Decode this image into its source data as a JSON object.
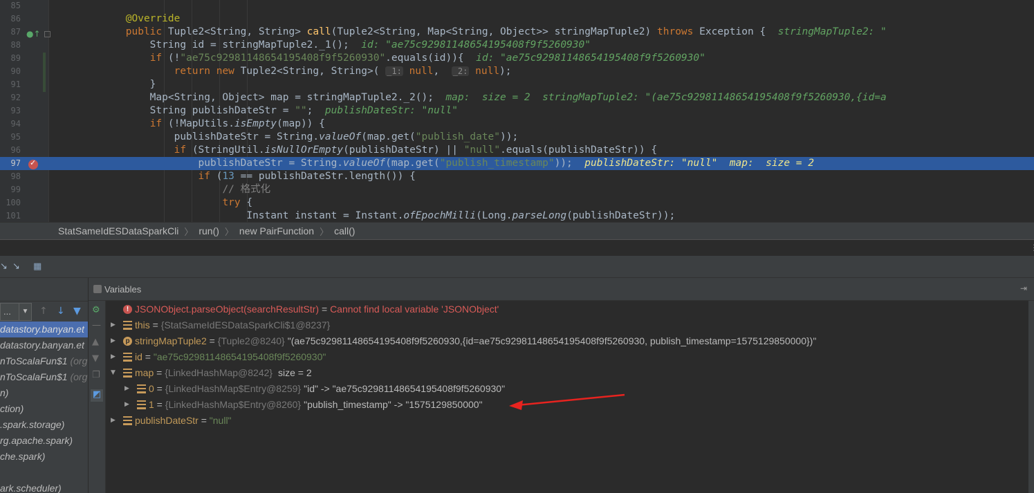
{
  "editor": {
    "lines": [
      {
        "n": "85",
        "segs": []
      },
      {
        "n": "86",
        "segs": [
          {
            "t": "            "
          },
          {
            "t": "@Override",
            "c": "ann"
          }
        ]
      },
      {
        "n": "87",
        "segs": [
          {
            "t": "            "
          },
          {
            "t": "public ",
            "c": "kw"
          },
          {
            "t": "Tuple2<String, String> "
          },
          {
            "t": "call",
            "c": "fn"
          },
          {
            "t": "(Tuple2<String, Map<String, Object>> stringMapTuple2) "
          },
          {
            "t": "throws ",
            "c": "kw"
          },
          {
            "t": "Exception {  "
          },
          {
            "t": "stringMapTuple2: \"",
            "c": "hint"
          }
        ]
      },
      {
        "n": "88",
        "segs": [
          {
            "t": "                String id = stringMapTuple2."
          },
          {
            "t": "_1",
            "c": ""
          },
          {
            "t": "();  "
          },
          {
            "t": "id: \"ae75c92981148654195408f9f5260930\"",
            "c": "hint"
          }
        ]
      },
      {
        "n": "89",
        "segs": [
          {
            "t": "                "
          },
          {
            "t": "if ",
            "c": "kw"
          },
          {
            "t": "(!"
          },
          {
            "t": "\"ae75c92981148654195408f9f5260930\"",
            "c": "str"
          },
          {
            "t": ".equals(id)){  "
          },
          {
            "t": "id: \"ae75c92981148654195408f9f5260930\"",
            "c": "hint"
          }
        ]
      },
      {
        "n": "90",
        "segs": [
          {
            "t": "                    "
          },
          {
            "t": "return new ",
            "c": "kw"
          },
          {
            "t": "Tuple2<String, String>( "
          },
          {
            "t": "_1:",
            "c": "ph"
          },
          {
            "t": " "
          },
          {
            "t": "null",
            "c": "kw"
          },
          {
            "t": ",  "
          },
          {
            "t": "_2:",
            "c": "ph"
          },
          {
            "t": " "
          },
          {
            "t": "null",
            "c": "kw"
          },
          {
            "t": ");"
          }
        ]
      },
      {
        "n": "91",
        "segs": [
          {
            "t": "                }"
          }
        ]
      },
      {
        "n": "92",
        "segs": [
          {
            "t": "                Map<String, Object> map = stringMapTuple2._2();  "
          },
          {
            "t": "map:  size = 2  stringMapTuple2: \"(ae75c92981148654195408f9f5260930,{id=a",
            "c": "hint"
          }
        ]
      },
      {
        "n": "93",
        "segs": [
          {
            "t": "                String publishDateStr = "
          },
          {
            "t": "\"\"",
            "c": "str"
          },
          {
            "t": ";  "
          },
          {
            "t": "publishDateStr: \"null\"",
            "c": "hint"
          }
        ]
      },
      {
        "n": "94",
        "segs": [
          {
            "t": "                "
          },
          {
            "t": "if ",
            "c": "kw"
          },
          {
            "t": "(!MapUtils."
          },
          {
            "t": "isEmpty",
            "c": "it"
          },
          {
            "t": "(map)) {"
          }
        ]
      },
      {
        "n": "95",
        "segs": [
          {
            "t": "                    publishDateStr = String."
          },
          {
            "t": "valueOf",
            "c": "it"
          },
          {
            "t": "(map.get("
          },
          {
            "t": "\"publish_date\"",
            "c": "str"
          },
          {
            "t": "));"
          }
        ]
      },
      {
        "n": "96",
        "segs": [
          {
            "t": "                    "
          },
          {
            "t": "if ",
            "c": "kw"
          },
          {
            "t": "(StringUtil."
          },
          {
            "t": "isNullOrEmpty",
            "c": "it"
          },
          {
            "t": "(publishDateStr) || "
          },
          {
            "t": "\"null\"",
            "c": "str"
          },
          {
            "t": ".equals(publishDateStr)) {"
          }
        ]
      },
      {
        "n": "97",
        "active": true,
        "segs": [
          {
            "t": "                        publishDateStr = String."
          },
          {
            "t": "valueOf",
            "c": "it"
          },
          {
            "t": "(map.get("
          },
          {
            "t": "\"publish_timestamp\"",
            "c": "str"
          },
          {
            "t": "));  "
          },
          {
            "t": "publishDateStr: \"null\"  map:  size = 2",
            "c": "hintA"
          }
        ]
      },
      {
        "n": "98",
        "segs": [
          {
            "t": "                        "
          },
          {
            "t": "if ",
            "c": "kw"
          },
          {
            "t": "("
          },
          {
            "t": "13",
            "c": "num"
          },
          {
            "t": " == publishDateStr.length()) {"
          }
        ]
      },
      {
        "n": "99",
        "segs": [
          {
            "t": "                            "
          },
          {
            "t": "// 格式化",
            "c": "cmt"
          }
        ]
      },
      {
        "n": "100",
        "segs": [
          {
            "t": "                            "
          },
          {
            "t": "try ",
            "c": "kw"
          },
          {
            "t": "{"
          }
        ]
      },
      {
        "n": "101",
        "segs": [
          {
            "t": "                                Instant instant = Instant."
          },
          {
            "t": "ofEpochMilli",
            "c": "it"
          },
          {
            "t": "(Long."
          },
          {
            "t": "parseLong",
            "c": "it"
          },
          {
            "t": "(publishDateStr));"
          }
        ]
      }
    ]
  },
  "breadcrumb": [
    "StatSameIdESDataSparkCli",
    "run()",
    "new PairFunction",
    "call()"
  ],
  "frames": {
    "select_label": "...",
    "items": [
      {
        "text": "datastory.banyan.et",
        "sel": true
      },
      {
        "text": "datastory.banyan.et",
        "sel": false
      },
      {
        "text": "nToScalaFun$1",
        "dim": " (org",
        "sel": false
      },
      {
        "text": "nToScalaFun$1",
        "dim": " (org",
        "sel": false
      },
      {
        "text": "n)",
        "sel": false
      },
      {
        "text": "ction)",
        "sel": false
      },
      {
        "text": ".spark.storage)",
        "sel": false
      },
      {
        "text": "rg.apache.spark)",
        "sel": false
      },
      {
        "text": "che.spark)",
        "sel": false
      },
      {
        "text": "",
        "sel": false
      },
      {
        "text": "ark.scheduler)",
        "sel": false
      }
    ]
  },
  "variables": {
    "title": "Variables",
    "rows": [
      {
        "indent": 0,
        "icon": "err",
        "name": "JSONObject.parseObject(searchResultStr)",
        "nameRed": true,
        "error": "Cannot find local variable 'JSONObject'"
      },
      {
        "indent": 0,
        "icon": "field",
        "expand": "right",
        "name": "this",
        "type": "{StatSameIdESDataSparkCli$1@8237}"
      },
      {
        "indent": 0,
        "icon": "param",
        "expand": "right",
        "name": "stringMapTuple2",
        "type": "{Tuple2@8240}",
        "value": "\"(ae75c92981148654195408f9f5260930,{id=ae75c92981148654195408f9f5260930, publish_timestamp=1575129850000})\""
      },
      {
        "indent": 0,
        "icon": "field",
        "expand": "right",
        "name": "id",
        "str": "\"ae75c92981148654195408f9f5260930\""
      },
      {
        "indent": 0,
        "icon": "field",
        "expand": "down",
        "name": "map",
        "type": "{LinkedHashMap@8242}",
        "value": " size = 2"
      },
      {
        "indent": 1,
        "icon": "field",
        "expand": "right",
        "name": "0",
        "type": "{LinkedHashMap$Entry@8259}",
        "value": "\"id\" -> \"ae75c92981148654195408f9f5260930\""
      },
      {
        "indent": 1,
        "icon": "field",
        "expand": "right",
        "name": "1",
        "type": "{LinkedHashMap$Entry@8260}",
        "value": "\"publish_timestamp\" -> \"1575129850000\""
      },
      {
        "indent": 0,
        "icon": "field",
        "expand": "right",
        "name": "publishDateStr",
        "str": "\"null\""
      }
    ]
  },
  "colors": {
    "annotation_arrow": "#e8231f",
    "active_line": "#2d5a9e"
  }
}
